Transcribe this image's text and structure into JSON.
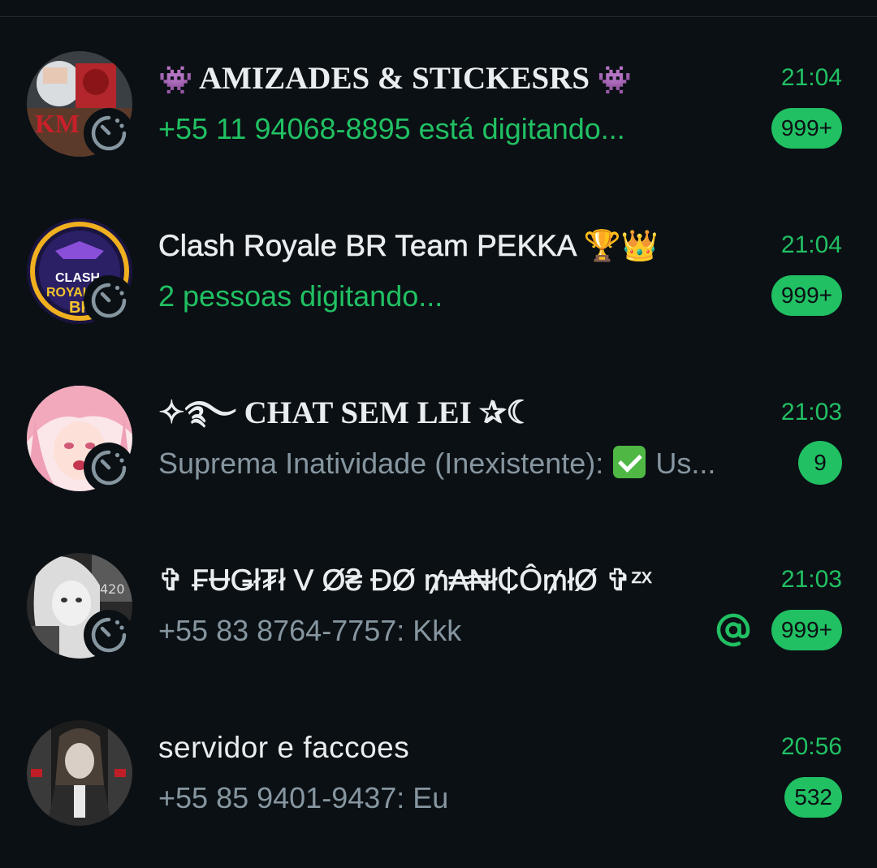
{
  "colors": {
    "background": "#0b1014",
    "accent_green": "#21c063",
    "title_text": "#e9edef",
    "secondary_text": "#8696a0"
  },
  "chats": [
    {
      "title": "AMIZADES & STICKESRS",
      "title_emoji_left": "👾",
      "title_emoji_right": "👾",
      "time": "21:04",
      "preview": "+55 11 94068-8895 está digitando...",
      "preview_style": "typing",
      "unread": "999+",
      "avatar_icon": "group-avatar-icon",
      "status_icon": "disappearing-timer-icon"
    },
    {
      "title": "Clash Royale BR Team PEKKA 🏆👑",
      "time": "21:04",
      "preview": "2 pessoas digitando...",
      "preview_style": "typing",
      "unread": "999+",
      "avatar_icon": "group-avatar-icon",
      "status_icon": "disappearing-timer-icon"
    },
    {
      "title": "✧࿐ CHAT SEM LEI ✰☾",
      "time": "21:03",
      "preview_sender": "Suprema Inatividade (Inexistente):",
      "preview_emoji": "check-mark-emoji",
      "preview_rest": "Us...",
      "unread": "9",
      "avatar_icon": "group-avatar-icon",
      "status_icon": "disappearing-timer-icon"
    },
    {
      "title": "✞ ₣ɄǤł₮ł V Ø₴ ĐØ ₥₳₦ł₵Ô₥łØ ✞ᶻˣ",
      "time": "21:03",
      "preview": "+55 83 8764-7757: Kkk",
      "mention_icon": "at-mention-icon",
      "unread": "999+",
      "avatar_icon": "group-avatar-icon",
      "status_icon": "disappearing-timer-icon"
    },
    {
      "title": "servidor e faccoes",
      "time": "20:56",
      "preview": "+55 85 9401-9437: Eu",
      "unread": "532",
      "avatar_icon": "group-avatar-icon"
    }
  ]
}
